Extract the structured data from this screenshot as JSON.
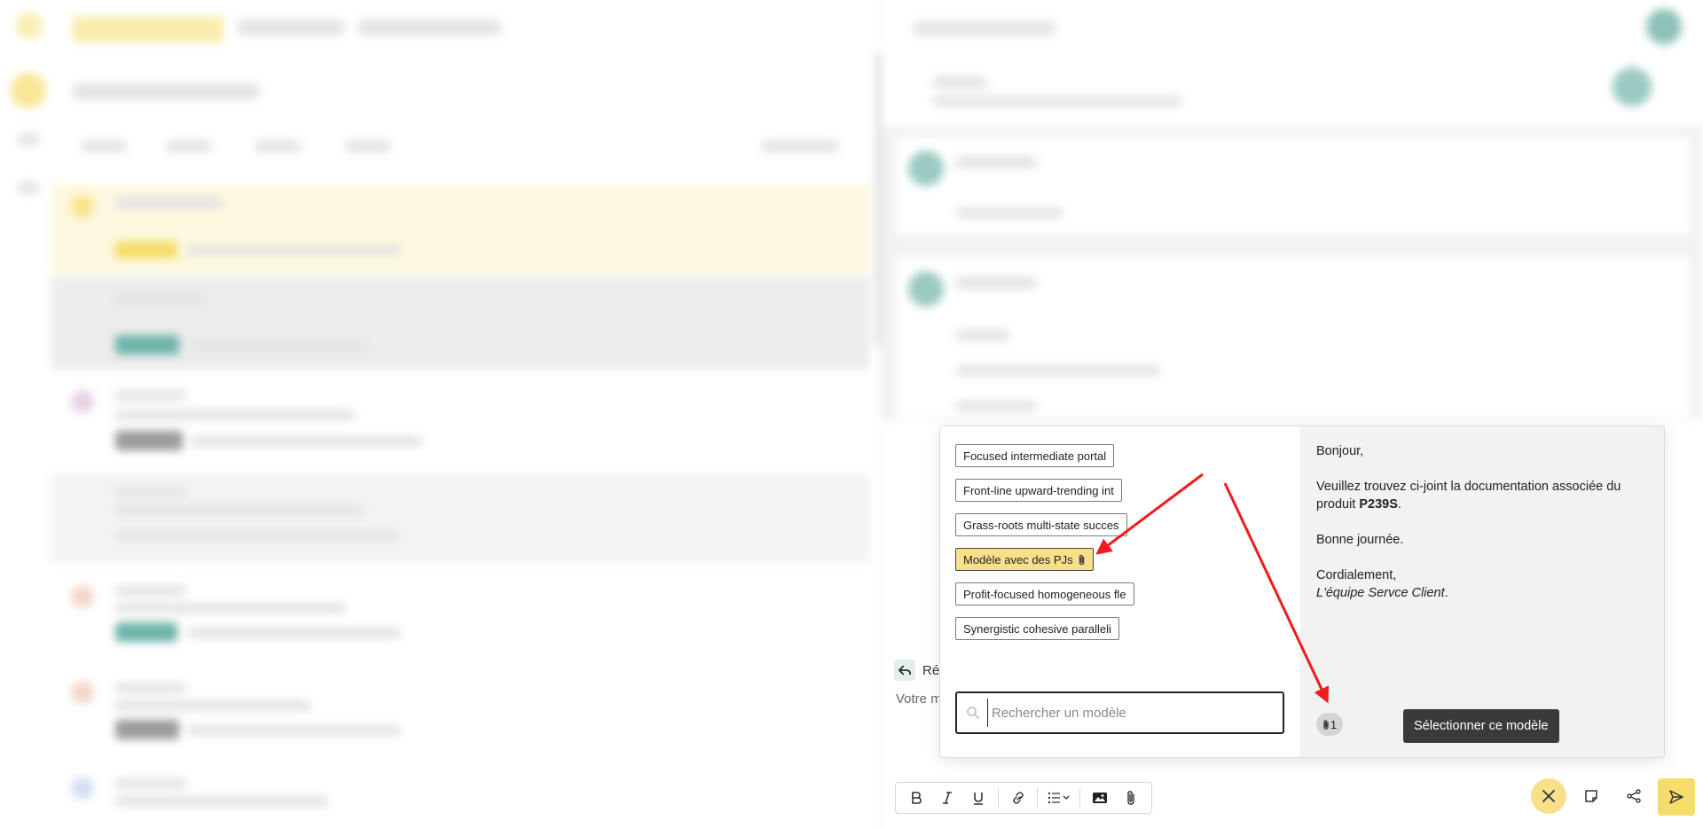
{
  "composer": {
    "reply_label": "Ré",
    "placeholder": "Votre m"
  },
  "template_picker": {
    "templates": [
      {
        "label": "Focused intermediate portal",
        "has_attachment": false,
        "selected": false
      },
      {
        "label": "Front-line upward-trending int",
        "has_attachment": false,
        "selected": false
      },
      {
        "label": "Grass-roots multi-state succes",
        "has_attachment": false,
        "selected": false
      },
      {
        "label": "Modèle avec des PJs",
        "has_attachment": true,
        "selected": true
      },
      {
        "label": "Profit-focused homogeneous fle",
        "has_attachment": false,
        "selected": false
      },
      {
        "label": "Synergistic cohesive paralleli",
        "has_attachment": false,
        "selected": false
      }
    ],
    "search_placeholder": "Rechercher un modèle",
    "preview": {
      "greeting": "Bonjour,",
      "body_prefix": "Veuillez trouvez ci-joint la documentation associée du produit ",
      "body_product": "P239S",
      "body_suffix": ".",
      "closing_line": "Bonne journée.",
      "signoff": "Cordialement,",
      "signature_italic": "L'équipe Servce Client",
      "signature_suffix": "."
    },
    "attachment_count": "1",
    "select_label": "Sélectionner ce modèle"
  },
  "colors": {
    "accent_yellow": "#f6dc6a",
    "selected_template": "#f8e08a",
    "dark_button": "#3a3a3a",
    "annotation_red": "#ee1c1c"
  },
  "icons": {
    "attachment": "paperclip-icon",
    "search": "search-icon",
    "close": "close-icon",
    "send": "send-icon",
    "note": "note-icon",
    "share": "share-icon"
  }
}
